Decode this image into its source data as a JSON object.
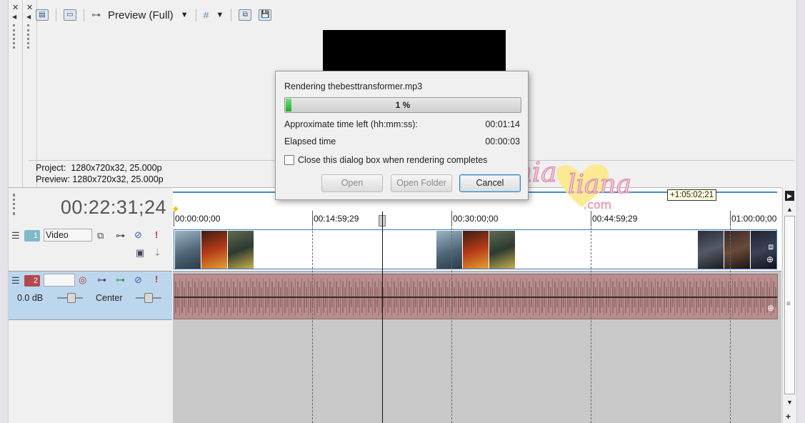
{
  "toolbar": {
    "preview_mode": "Preview (Full)"
  },
  "project_info": {
    "project_label": "Project:",
    "project_value": "1280x720x32, 25.000p",
    "preview_label": "Preview:",
    "preview_value": "1280x720x32, 25.000p"
  },
  "timeline": {
    "timecode": "00:22:31;24",
    "loop_region": "+1:05:02;21",
    "ruler_ticks": [
      "00:00:00;00",
      "00:14:59;29",
      "00:30:00;00",
      "00:44:59;29",
      "01:00:00;00"
    ]
  },
  "tracks": {
    "video": {
      "number": "1",
      "name": "Video"
    },
    "audio": {
      "number": "2",
      "name": "",
      "volume": "0.0 dB",
      "pan": "Center"
    }
  },
  "dialog": {
    "title": "Rendering thebesttransformer.mp3",
    "progress_text": "1 %",
    "progress_value": 1,
    "time_left_label": "Approximate time left (hh:mm:ss):",
    "time_left_value": "00:01:14",
    "elapsed_label": "Elapsed time",
    "elapsed_value": "00:00:03",
    "close_checkbox_label": "Close this dialog box when rendering completes",
    "open_button": "Open",
    "open_folder_button": "Open Folder",
    "cancel_button": "Cancel"
  },
  "watermark": {
    "line1": "mia",
    "line2": "liana",
    "line3": ".com"
  },
  "colors": {
    "accent_blue": "#3f8ad8",
    "audio_track": "#bcd6ee",
    "audio_clip": "#b98d8d",
    "progress_green": "#1fae2c",
    "video_track_num": "#7fb9c9",
    "audio_track_num": "#b5484e"
  }
}
